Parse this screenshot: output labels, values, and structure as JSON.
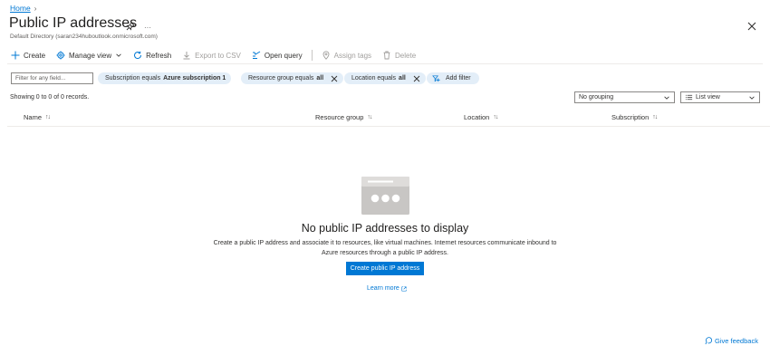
{
  "breadcrumb": {
    "home": "Home",
    "separator": "›"
  },
  "header": {
    "title": "Public IP addresses",
    "subtitle": "Default Directory (saran234huboutlook.onmicrosoft.com)",
    "more": "···"
  },
  "toolbar": {
    "create": "Create",
    "manage_view": "Manage view",
    "refresh": "Refresh",
    "export_csv": "Export to CSV",
    "open_query": "Open query",
    "assign_tags": "Assign tags",
    "delete": "Delete"
  },
  "filters": {
    "search_placeholder": "Filter for any field...",
    "subscription": {
      "label": "Subscription equals",
      "value": "Azure subscription 1"
    },
    "resource_group": {
      "label": "Resource group equals",
      "value": "all"
    },
    "location": {
      "label": "Location equals",
      "value": "all"
    },
    "add_filter": "Add filter"
  },
  "records": "Showing 0 to 0 of 0 records.",
  "grouping": {
    "selected": "No grouping"
  },
  "view": {
    "selected": "List view"
  },
  "columns": {
    "name": "Name",
    "resource_group": "Resource group",
    "location": "Location",
    "subscription": "Subscription"
  },
  "empty": {
    "title": "No public IP addresses to display",
    "description": "Create a public IP address and associate it to resources, like virtual machines. Internet resources communicate inbound to Azure resources through a public IP address.",
    "button": "Create public IP address",
    "learn_more": "Learn more"
  },
  "feedback": "Give feedback",
  "colors": {
    "accent": "#0078d4",
    "pill_bg": "#e3eef8"
  }
}
